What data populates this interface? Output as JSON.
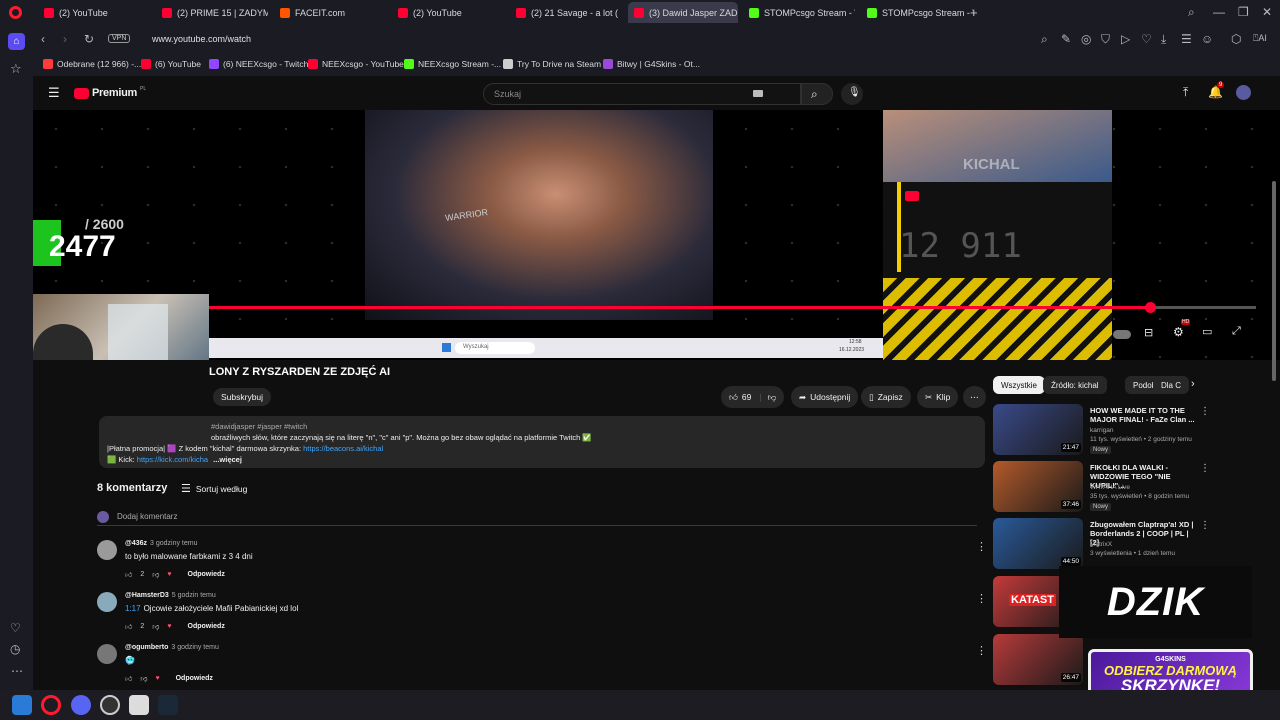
{
  "browser": {
    "tabs": [
      {
        "label": "(2) YouTube",
        "icon": "youtube-icon"
      },
      {
        "label": "(2) PRIME 15 | ZADYMA",
        "icon": "youtube-icon"
      },
      {
        "label": "FACEIT.com",
        "icon": "faceit-icon"
      },
      {
        "label": "(2) YouTube",
        "icon": "youtube-icon"
      },
      {
        "label": "(2) 21 Savage - a lot (",
        "icon": "youtube-icon"
      },
      {
        "label": "(3) Dawid Jasper ZADO",
        "icon": "youtube-icon"
      },
      {
        "label": "STOMPcsgo Stream - Wat",
        "icon": "kick-icon"
      },
      {
        "label": "STOMPcsgo Stream - Wat",
        "icon": "kick-icon"
      }
    ],
    "new_tab": "+",
    "vpn": "VPN",
    "url": "www.youtube.com/watch",
    "bookmarks": [
      "Odebrane (12 966) -...",
      "(6) YouTube",
      "(6) NEEXcsgo - Twitch",
      "NEEXcsgo - YouTube",
      "NEEXcsgo Stream -...",
      "Try To Drive na Steam",
      "Bitwy | G4Skins - Ot..."
    ]
  },
  "youtube": {
    "logo": "Premium",
    "logo_suffix": "PL",
    "search_placeholder": "Szukaj",
    "notification_count": "9",
    "overlay": {
      "counter_total": "/ 2600",
      "counter_value": "2477",
      "kichal_watermark": "KICHAL",
      "kichal_count": "12 911",
      "mini_search": "Wyszukaj",
      "mini_time": "12:58",
      "mini_date": "16.12.2023",
      "hd_badge": "HD"
    },
    "video": {
      "title": "LONY Z RYSZARDEN ZE ZDJĘĆ AI",
      "subscribe": "Subskrybuj",
      "likes": "69",
      "share": "Udostępnij",
      "save": "Zapisz",
      "clip": "Klip",
      "tags": "#dawidjasper #jasper #twitch",
      "desc_line1": "obraźliwych słów, które zaczynają się na literę \"n\", \"c\" ani \"p\". Można go bez obaw oglądać na platformie Twitch ✅",
      "desc_line2_prefix": "|Płatna promocja| 🟪 Z kodem \"kichal\" darmowa skrzynka:",
      "desc_line2_link": "https://beacons.ai/kichal",
      "desc_line3_prefix": "🟩 Kick:",
      "desc_line3_link": "https://kick.com/kicha",
      "more": "...więcej"
    },
    "comments": {
      "count_label": "8 komentarzy",
      "sort_label": "Sortuj według",
      "add_placeholder": "Dodaj komentarz",
      "reply_label": "Odpowiedz",
      "items": [
        {
          "author": "@436z",
          "time": "3 godziny temu",
          "text": "to było malowane farbkami z 3 4 dni",
          "timestamp": "",
          "likes": "2"
        },
        {
          "author": "@HamsterD3",
          "time": "5 godzin temu",
          "text": "Ojcowie założyciele Mafii Pabianickiej xd lol",
          "timestamp": "1:17",
          "likes": "2"
        },
        {
          "author": "@ogumberto",
          "time": "3 godziny temu",
          "text": "🥶",
          "timestamp": "",
          "likes": ""
        }
      ]
    },
    "chips": [
      "Wszystkie",
      "Źródło: kichal",
      "Podobne",
      "Dla C"
    ],
    "recommendations": [
      {
        "title": "HOW WE MADE IT TO THE MAJOR FINAL! - FaZe Clan ...",
        "channel": "karrigan",
        "meta": "11 tys. wyświetleń • 2 godziny temu",
        "badge": "Nowy",
        "duration": "21:47",
        "color": "#3a4a8a"
      },
      {
        "title": "FIKOŁKI DLA WALKI - WIDZOWIE TEGO \"NIE KUPILI\"...",
        "channel": "WATAHA Live",
        "meta": "35 tys. wyświetleń • 8 godzin temu",
        "badge": "Nowy",
        "duration": "37:46",
        "color": "#b45a2a"
      },
      {
        "title": "Zbugowałem Claptrap'a! XD | Borderlands 2 | COOP | PL | [2]",
        "channel": "MatrixX",
        "meta": "3 wyświetlenia • 1 dzień temu",
        "badge": "",
        "duration": "44:50",
        "color": "#2a5a9a"
      },
      {
        "title": "",
        "channel": "",
        "meta": "",
        "badge": "",
        "duration": "",
        "color": "#c43a3a",
        "overlay": "KATAST"
      },
      {
        "title": "",
        "channel": "",
        "meta": "",
        "badge": "",
        "duration": "26:47",
        "color": "#b83a3a"
      }
    ],
    "ads": {
      "dzik": "DZIK",
      "g4_brand": "G4SKINS",
      "g4_line1": "ODBIERZ DARMOWĄ",
      "g4_line2": "SKRZYNKĘ!"
    }
  }
}
